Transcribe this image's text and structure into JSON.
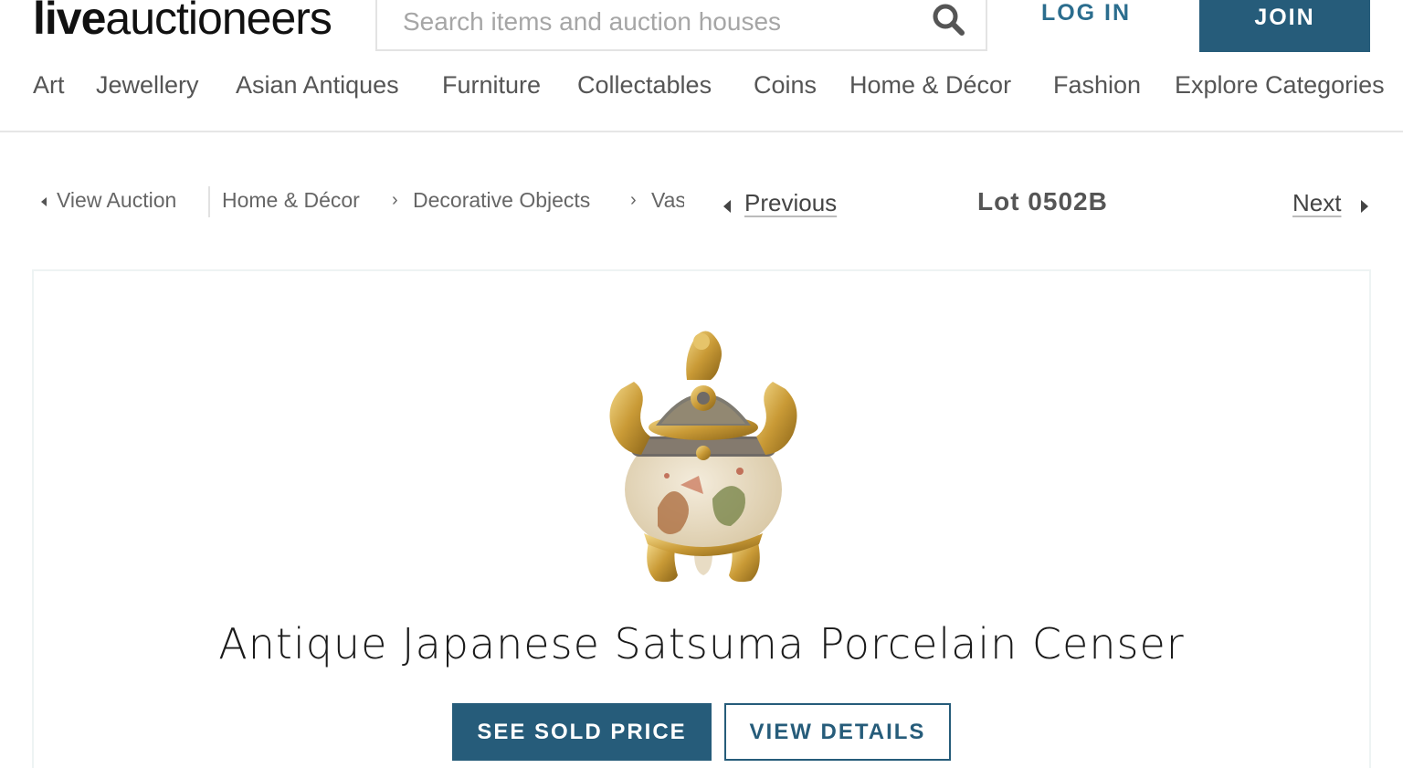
{
  "header": {
    "logo_bold": "live",
    "logo_light": "auctioneers",
    "search_placeholder": "Search items and auction houses",
    "login_label": "LOG IN",
    "join_label": "JOIN"
  },
  "categories": [
    "Art",
    "Jewellery",
    "Asian Antiques",
    "Furniture",
    "Collectables",
    "Coins",
    "Home & Décor",
    "Fashion",
    "Explore Categories"
  ],
  "breadcrumb": {
    "back_label": "View Auction",
    "items": [
      "Home & Décor",
      "Decorative Objects",
      "Vases"
    ],
    "separator": "›"
  },
  "lot_nav": {
    "previous_label": "Previous",
    "lot_label": "Lot 0502B",
    "next_label": "Next"
  },
  "item": {
    "title": "Antique Japanese Satsuma Porcelain Censer",
    "image_icon": "satsuma-censer-image"
  },
  "actions": {
    "sold_price_label": "SEE SOLD PRICE",
    "details_label": "VIEW DETAILS"
  },
  "colors": {
    "brand": "#265c7a",
    "link": "#2b6d8e"
  }
}
